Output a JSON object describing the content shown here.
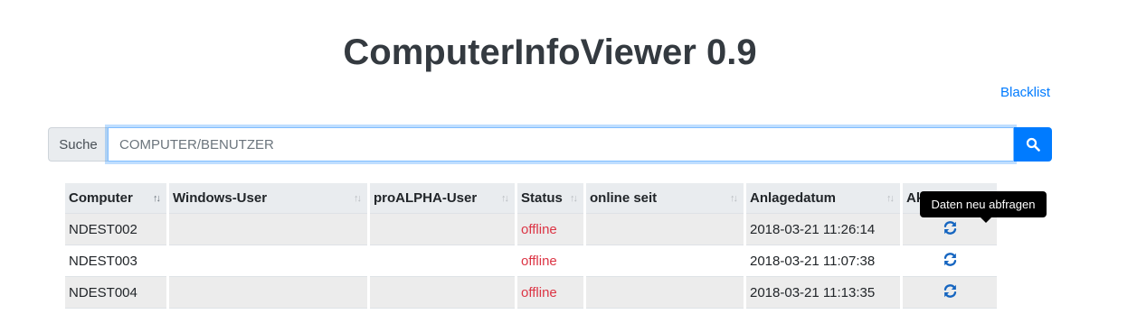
{
  "header": {
    "title": "ComputerInfoViewer 0.9",
    "blacklist_link": "Blacklist"
  },
  "search": {
    "label": "Suche",
    "placeholder": "COMPUTER/BENUTZER",
    "value": "",
    "button_icon": "search-icon"
  },
  "table": {
    "columns": [
      "Computer",
      "Windows-User",
      "proALPHA-User",
      "Status",
      "online seit",
      "Anlagedatum",
      "Aktionen"
    ],
    "rows": [
      {
        "computer": "NDEST002",
        "windows_user": "",
        "proalpha_user": "",
        "status": "offline",
        "online_since": "",
        "created": "2018-03-21 11:26:14",
        "action_icon": "refresh-icon"
      },
      {
        "computer": "NDEST003",
        "windows_user": "",
        "proalpha_user": "",
        "status": "offline",
        "online_since": "",
        "created": "2018-03-21 11:07:38",
        "action_icon": "refresh-icon"
      },
      {
        "computer": "NDEST004",
        "windows_user": "",
        "proalpha_user": "",
        "status": "offline",
        "online_since": "",
        "created": "2018-03-21 11:13:35",
        "action_icon": "refresh-icon"
      }
    ]
  },
  "tooltip": {
    "text": "Daten neu abfragen"
  },
  "colors": {
    "accent": "#007bff",
    "status_offline": "#dc3545",
    "icon_blue": "#1565c0"
  }
}
